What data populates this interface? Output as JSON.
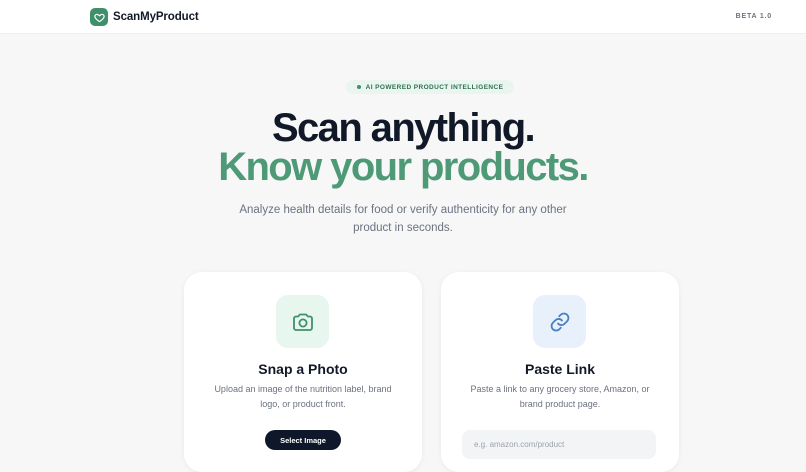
{
  "header": {
    "brand_name": "ScanMyProduct",
    "logo_icon": "heart-shield-icon",
    "version_label": "BETA 1.0"
  },
  "hero": {
    "badge": "AI POWERED PRODUCT INTELLIGENCE",
    "headline_line1": "Scan anything.",
    "headline_line2": "Know your products.",
    "subtitle": "Analyze health details for food or verify authenticity for any other product in seconds."
  },
  "cards": {
    "photo": {
      "icon": "camera-icon",
      "title": "Snap a Photo",
      "description": "Upload an image of the nutrition label, brand logo, or product front.",
      "button_label": "Select Image"
    },
    "link": {
      "icon": "link-icon",
      "title": "Paste Link",
      "description": "Paste a link to any grocery store, Amazon, or brand product page.",
      "input_placeholder": "e.g. amazon.com/product",
      "input_value": ""
    }
  },
  "colors": {
    "brand_green": "#3f8f6b",
    "headline_green": "#4e9a77",
    "dark": "#111827",
    "button": "#0f172a"
  }
}
